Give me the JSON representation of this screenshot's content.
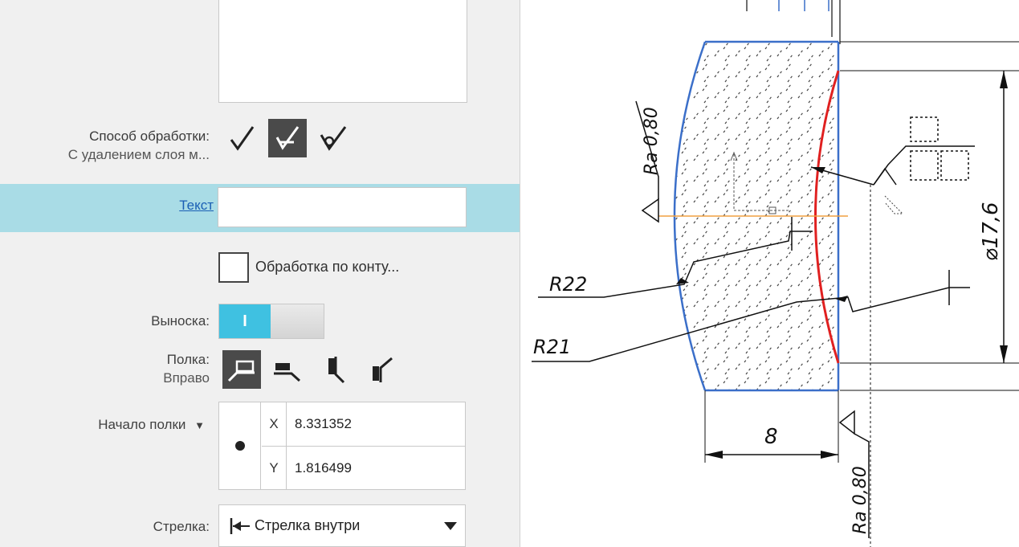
{
  "panel": {
    "method_label": "Способ обработки:",
    "method_value": "С удалением слоя м...",
    "method_icons": [
      "roughness-generic-icon",
      "roughness-removal-icon",
      "roughness-no-removal-icon"
    ],
    "text_link": "Текст",
    "text_value": "",
    "contour_label": "Обработка по конту...",
    "contour_checked": false,
    "leader_label": "Выноска:",
    "leader_toggle_state": "I",
    "shelf_label": "Полка:",
    "shelf_value": "Вправо",
    "shelf_icons": [
      "shelf-right-icon",
      "shelf-left-icon",
      "shelf-up-icon",
      "shelf-angled-icon"
    ],
    "shelf_start_label": "Начало полки",
    "x_axis": "X",
    "x_value": "8.331352",
    "y_axis": "Y",
    "y_value": "1.816499",
    "arrow_label": "Стрелка:",
    "arrow_value": "Стрелка внутри"
  },
  "drawing": {
    "roughness_top": "Ra 0,80",
    "roughness_bottom": "Ra 0,80",
    "radius_upper": "R22",
    "radius_lower": "R21",
    "dim_width": "8",
    "dim_diameter": "⌀17,6",
    "colors": {
      "profile": "#3b6fc9",
      "highlight": "#e02020",
      "axis": "#f0a040",
      "dim": "#111111"
    }
  }
}
